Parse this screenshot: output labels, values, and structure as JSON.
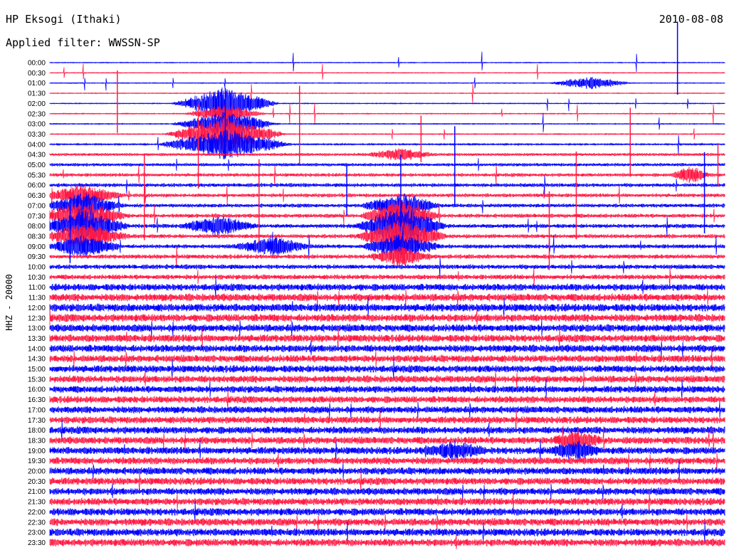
{
  "header": {
    "station": "HP Eksogi (Ithaki)",
    "date": "2010-08-08",
    "filter": "Applied filter: WWSSN-SP"
  },
  "chart_data": {
    "type": "line",
    "title": "HP Eksogi (Ithaki)",
    "subtitle": "Applied filter: WWSSN-SP",
    "ylabel": "HHZ - 20000",
    "xlabel": "",
    "grid": false,
    "colors": [
      "#0000ff",
      "#ff1a45"
    ],
    "rows": [
      "00:00",
      "00:30",
      "01:00",
      "01:30",
      "02:00",
      "02:30",
      "03:00",
      "03:30",
      "04:00",
      "04:30",
      "05:00",
      "05:30",
      "06:00",
      "06:30",
      "07:00",
      "07:30",
      "08:00",
      "08:30",
      "09:00",
      "09:30",
      "10:00",
      "10:30",
      "11:00",
      "11:30",
      "12:00",
      "12:30",
      "13:00",
      "13:30",
      "14:00",
      "14:30",
      "15:00",
      "15:30",
      "16:00",
      "16:30",
      "17:00",
      "17:30",
      "18:00",
      "18:30",
      "19:00",
      "19:30",
      "20:00",
      "20:30",
      "21:00",
      "21:30",
      "22:00",
      "22:30",
      "23:00",
      "23:30"
    ],
    "noise_level": [
      0.25,
      0.25,
      0.25,
      0.25,
      0.28,
      0.3,
      0.3,
      0.35,
      0.5,
      0.9,
      1.0,
      1.1,
      1.2,
      1.2,
      1.2,
      1.3,
      1.3,
      1.3,
      1.3,
      1.4,
      1.5,
      1.6,
      2.4,
      2.6,
      2.7,
      2.7,
      2.6,
      2.6,
      2.6,
      2.5,
      2.5,
      2.5,
      2.4,
      2.4,
      2.4,
      2.4,
      2.5,
      2.5,
      2.5,
      2.5,
      2.5,
      2.5,
      2.5,
      2.5,
      2.6,
      2.6,
      2.6,
      2.6
    ],
    "events": [
      {
        "row": 2,
        "pos": 0.8,
        "amp": 6,
        "width": 0.06
      },
      {
        "row": 4,
        "pos": 0.26,
        "amp": 16,
        "width": 0.08
      },
      {
        "row": 5,
        "pos": 0.26,
        "amp": 9,
        "width": 0.06
      },
      {
        "row": 6,
        "pos": 0.26,
        "amp": 12,
        "width": 0.08
      },
      {
        "row": 7,
        "pos": 0.26,
        "amp": 18,
        "width": 0.09
      },
      {
        "row": 8,
        "pos": 0.26,
        "amp": 15,
        "width": 0.1
      },
      {
        "row": 9,
        "pos": 0.52,
        "amp": 6,
        "width": 0.05
      },
      {
        "row": 13,
        "pos": 0.05,
        "amp": 10,
        "width": 0.06
      },
      {
        "row": 14,
        "pos": 0.05,
        "amp": 12,
        "width": 0.06
      },
      {
        "row": 15,
        "pos": 0.05,
        "amp": 14,
        "width": 0.07
      },
      {
        "row": 16,
        "pos": 0.05,
        "amp": 14,
        "width": 0.07
      },
      {
        "row": 17,
        "pos": 0.05,
        "amp": 12,
        "width": 0.07
      },
      {
        "row": 18,
        "pos": 0.05,
        "amp": 10,
        "width": 0.06
      },
      {
        "row": 14,
        "pos": 0.52,
        "amp": 12,
        "width": 0.06
      },
      {
        "row": 15,
        "pos": 0.52,
        "amp": 16,
        "width": 0.06
      },
      {
        "row": 16,
        "pos": 0.52,
        "amp": 18,
        "width": 0.07
      },
      {
        "row": 17,
        "pos": 0.52,
        "amp": 16,
        "width": 0.07
      },
      {
        "row": 18,
        "pos": 0.52,
        "amp": 12,
        "width": 0.06
      },
      {
        "row": 19,
        "pos": 0.52,
        "amp": 8,
        "width": 0.05
      },
      {
        "row": 16,
        "pos": 0.25,
        "amp": 9,
        "width": 0.06
      },
      {
        "row": 18,
        "pos": 0.33,
        "amp": 9,
        "width": 0.06
      },
      {
        "row": 11,
        "pos": 0.95,
        "amp": 8,
        "width": 0.03
      },
      {
        "row": 38,
        "pos": 0.6,
        "amp": 7,
        "width": 0.05
      },
      {
        "row": 37,
        "pos": 0.78,
        "amp": 8,
        "width": 0.04
      },
      {
        "row": 38,
        "pos": 0.78,
        "amp": 8,
        "width": 0.04
      }
    ]
  }
}
